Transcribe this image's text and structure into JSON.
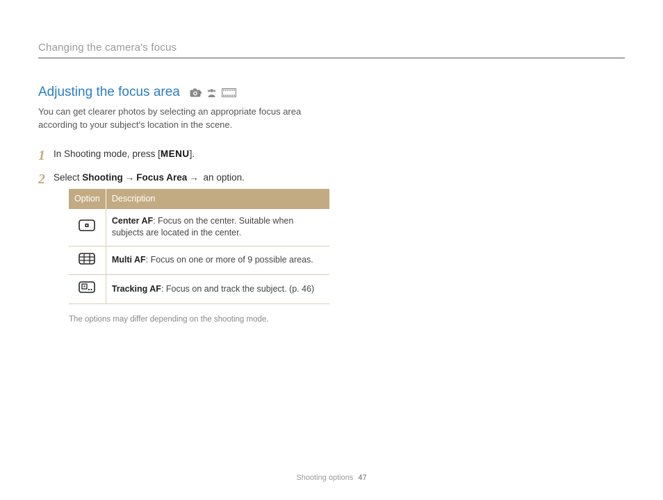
{
  "breadcrumb": "Changing the camera's focus",
  "section_title": "Adjusting the focus area",
  "mode_icons": [
    "camera-mode-icon",
    "dual-mode-icon",
    "video-mode-icon"
  ],
  "intro": "You can get clearer photos by selecting an appropriate focus area according to your subject's location in the scene.",
  "steps": {
    "s1_pre": "In Shooting mode, press [",
    "s1_key": "MENU",
    "s1_post": "].",
    "s2_pre": "Select ",
    "s2_b1": "Shooting",
    "s2_arrow": "→",
    "s2_b2": "Focus Area",
    "s2_post": " an option."
  },
  "table": {
    "head_option": "Option",
    "head_desc": "Description",
    "rows": [
      {
        "icon": "center-af-icon",
        "name": "Center AF",
        "desc": ": Focus on the center. Suitable when subjects are located in the center."
      },
      {
        "icon": "multi-af-icon",
        "name": "Multi AF",
        "desc": ": Focus on one or more of 9 possible areas."
      },
      {
        "icon": "tracking-af-icon",
        "name": "Tracking AF",
        "desc": ": Focus on and track the subject. (p. 46)"
      }
    ]
  },
  "footnote": "The options may differ depending on the shooting mode.",
  "footer_label": "Shooting options",
  "footer_page": "47"
}
